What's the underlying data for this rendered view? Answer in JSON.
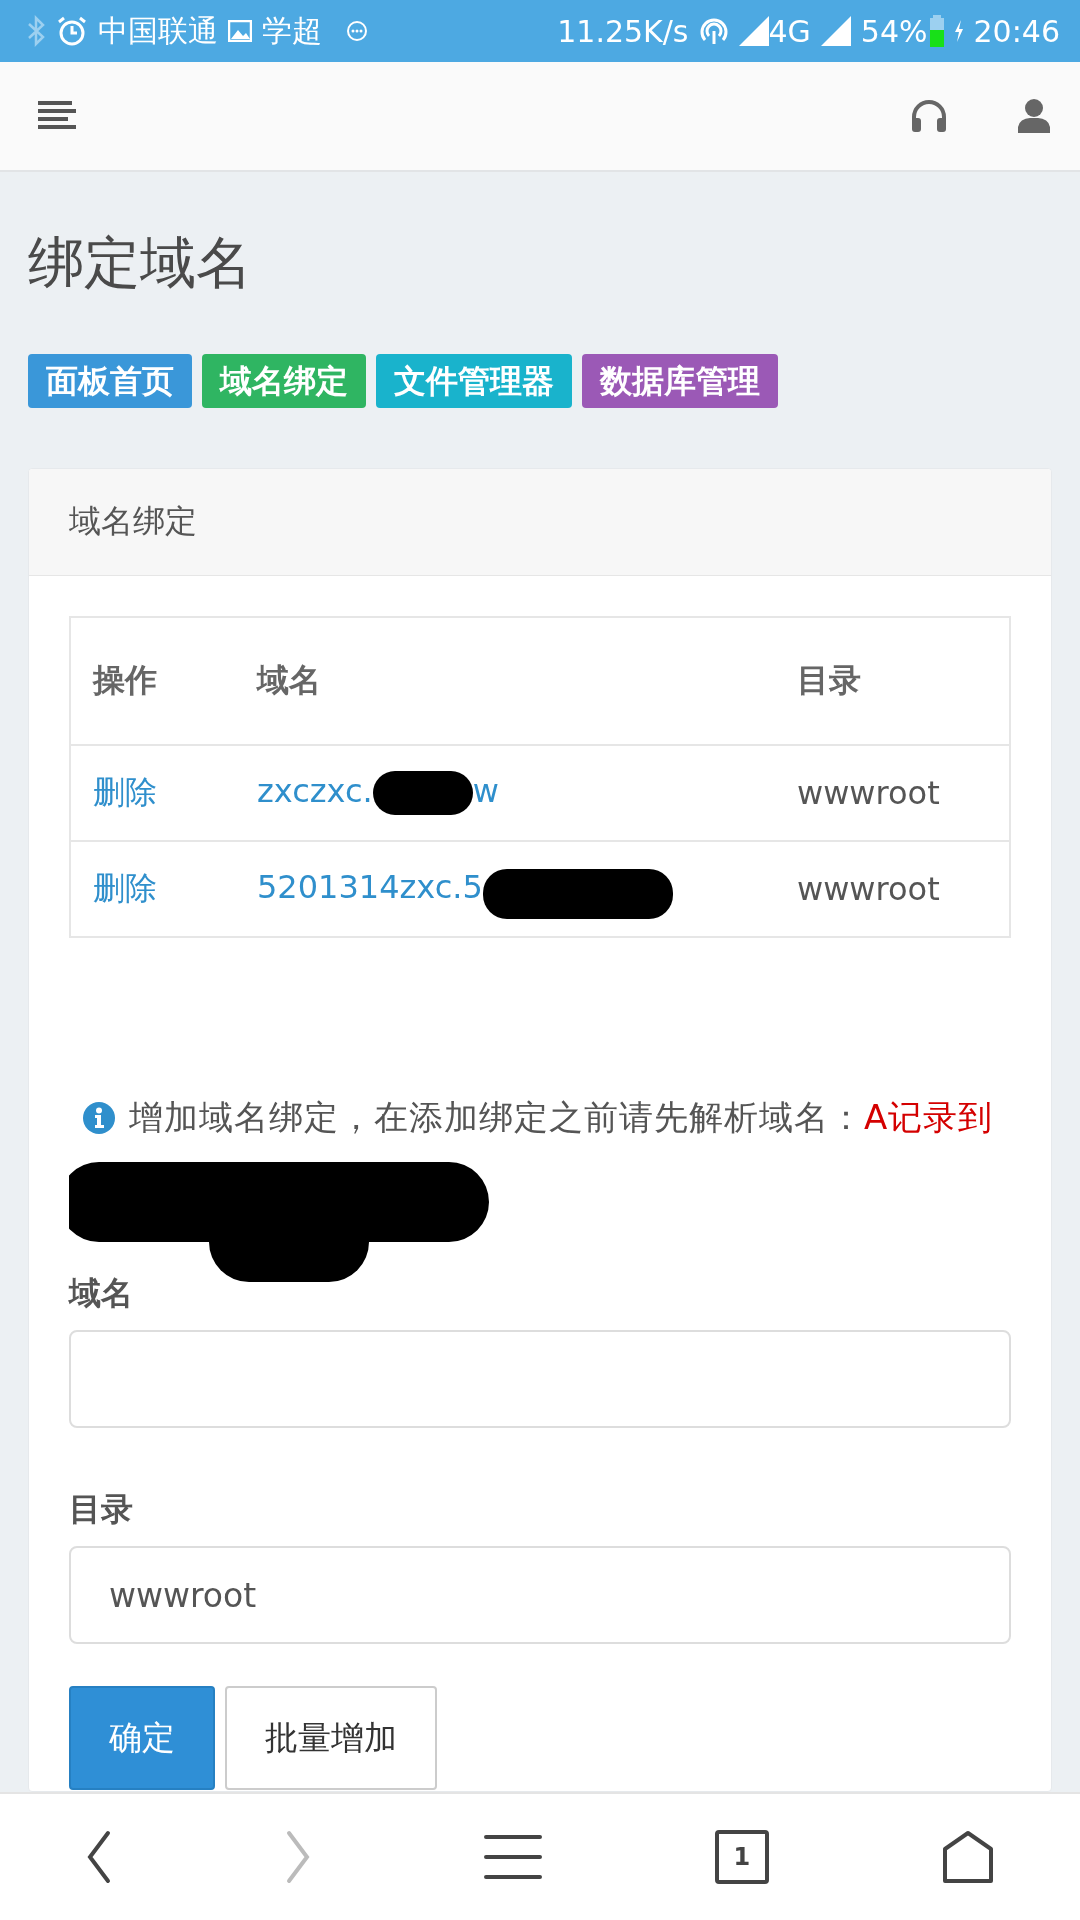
{
  "status_bar": {
    "carrier": "中国联通",
    "app": "学超",
    "speed": "11.25K/s",
    "network": "4G",
    "battery": "54%",
    "time": "20:46"
  },
  "page_title": "绑定域名",
  "nav_badges": [
    {
      "label": "面板首页",
      "color": "#3a97d9"
    },
    {
      "label": "域名绑定",
      "color": "#2fb562"
    },
    {
      "label": "文件管理器",
      "color": "#19b3cc"
    },
    {
      "label": "数据库管理",
      "color": "#9b59b6"
    }
  ],
  "card": {
    "title": "域名绑定",
    "table": {
      "columns": [
        "操作",
        "域名",
        "目录"
      ],
      "rows": [
        {
          "action": "删除",
          "domain_parts": [
            {
              "kind": "text",
              "text": "zxczxc."
            },
            {
              "kind": "redaction"
            },
            {
              "kind": "text",
              "text": "w"
            }
          ],
          "directory": "wwwroot"
        },
        {
          "action": "删除",
          "domain_parts": [
            {
              "kind": "text",
              "text": "5201314zxc.5"
            },
            {
              "kind": "redaction"
            }
          ],
          "directory": "wwwroot"
        }
      ]
    },
    "notice": {
      "text": "增加域名绑定，在添加绑定之前请先解析域名：",
      "highlight_parts": [
        {
          "kind": "text",
          "text": "A记录到"
        },
        {
          "kind": "redaction"
        }
      ]
    },
    "fields": [
      {
        "label": "域名"
      },
      {
        "label": "目录",
        "value": "wwwroot"
      }
    ],
    "buttons": [
      {
        "label": "确定",
        "kind": "primary"
      },
      {
        "label": "批量增加",
        "kind": "default"
      }
    ]
  },
  "bottom_nav": {
    "back_disabled": false,
    "forward_disabled": true,
    "tab_count": "1"
  }
}
